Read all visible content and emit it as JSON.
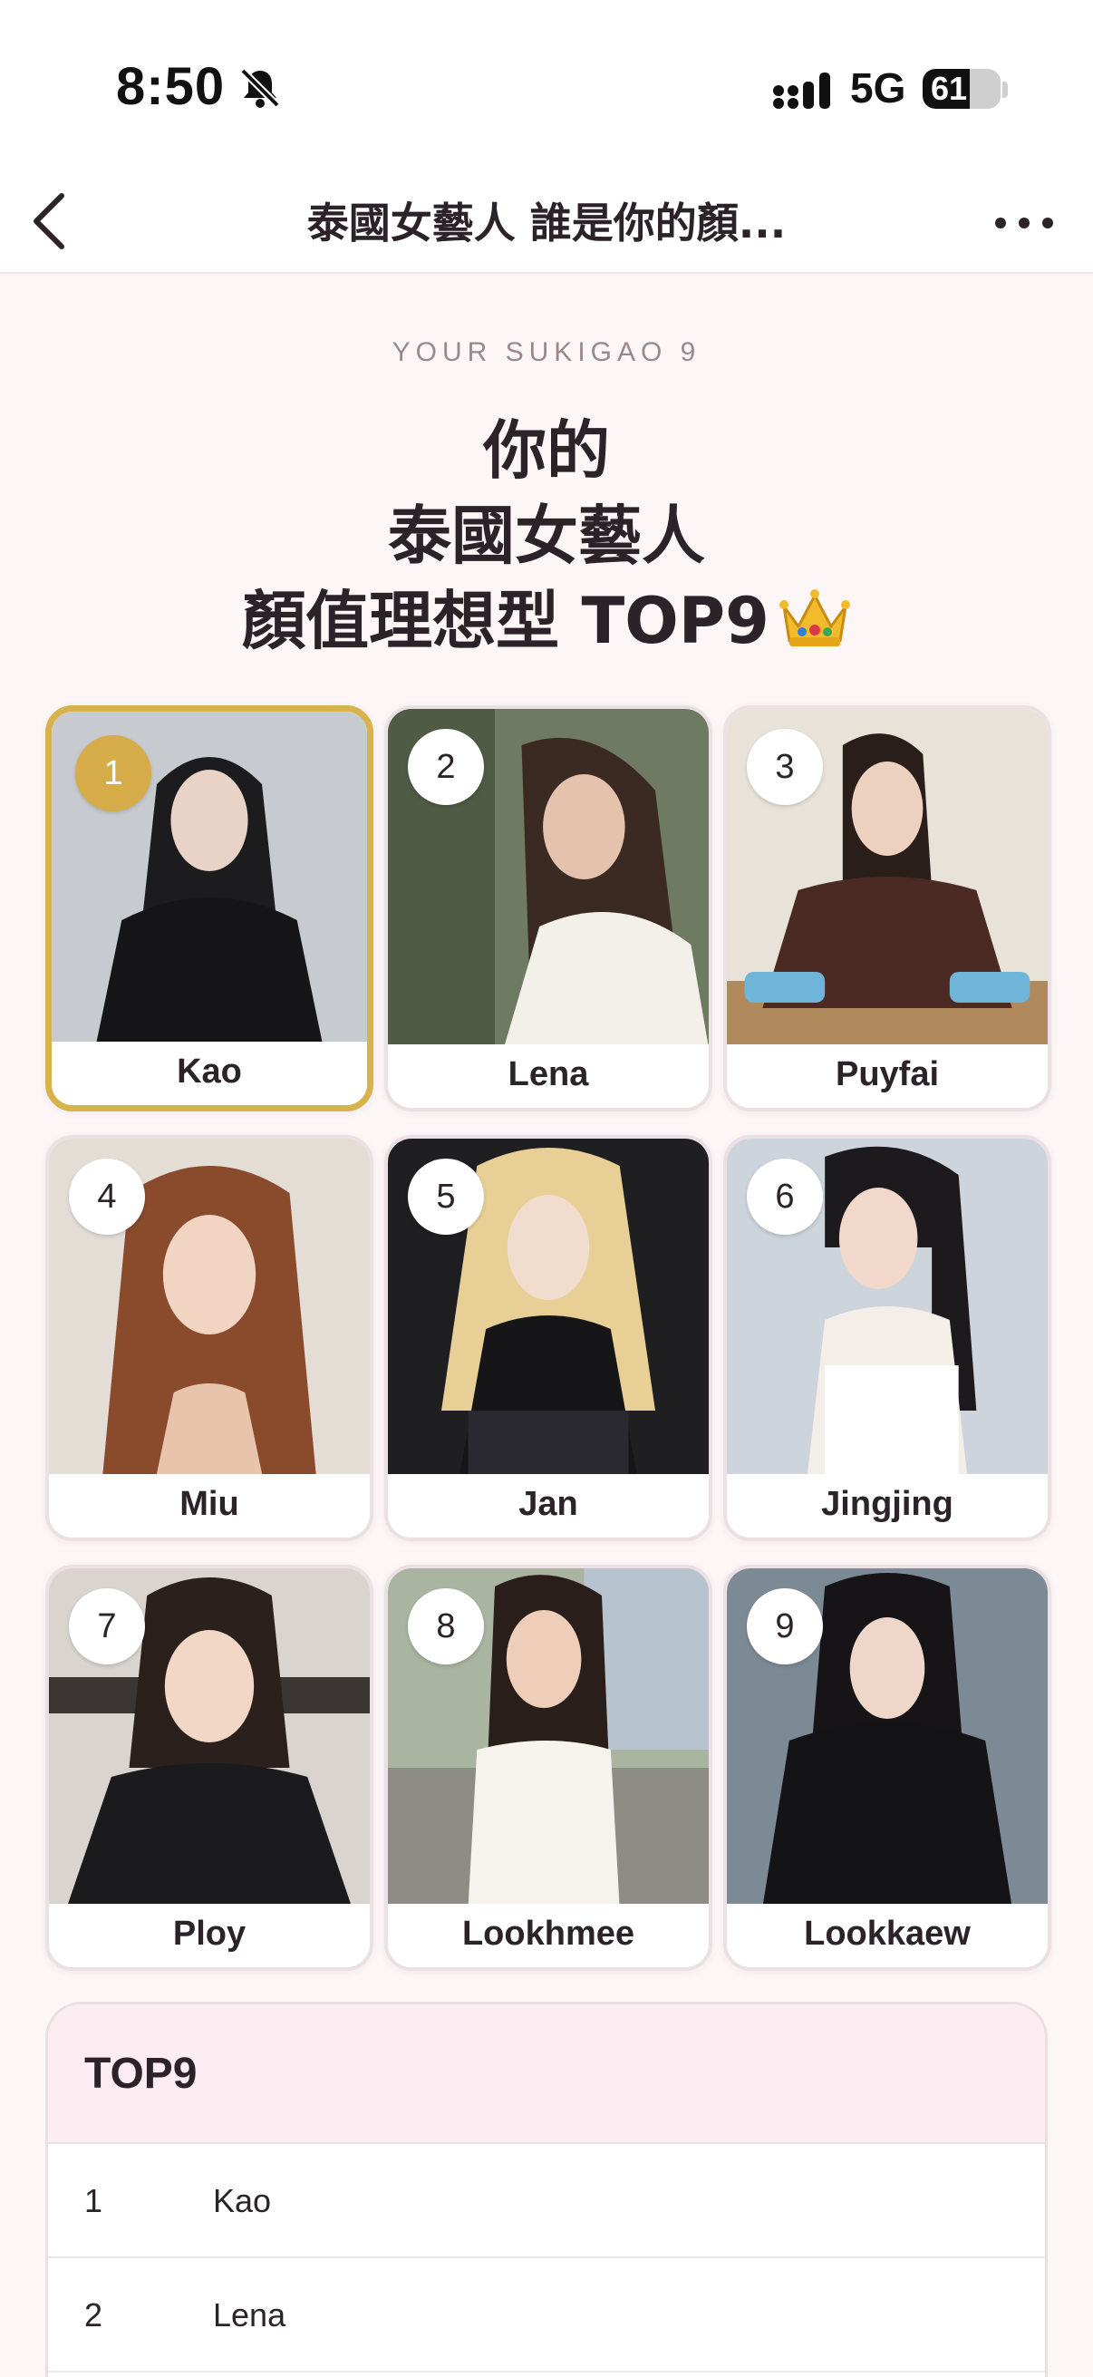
{
  "status_bar": {
    "time": "8:50",
    "network": "5G",
    "battery_level": 61,
    "battery_label": "61",
    "icons": [
      "bell-off-icon",
      "signal-icon",
      "battery-icon"
    ]
  },
  "nav": {
    "title": "泰國女藝人 誰是你的顏...",
    "icons": [
      "back-icon",
      "more-icon"
    ]
  },
  "header": {
    "eyebrow": "YOUR SUKIGAO 9",
    "line1": "你的",
    "line2": "泰國女藝人",
    "line3": "顏值理想型 TOP9",
    "icon": "crown-icon"
  },
  "cards": [
    {
      "rank": "1",
      "name": "Kao"
    },
    {
      "rank": "2",
      "name": "Lena"
    },
    {
      "rank": "3",
      "name": "Puyfai"
    },
    {
      "rank": "4",
      "name": "Miu"
    },
    {
      "rank": "5",
      "name": "Jan"
    },
    {
      "rank": "6",
      "name": "Jingjing"
    },
    {
      "rank": "7",
      "name": "Ploy"
    },
    {
      "rank": "8",
      "name": "Lookhmee"
    },
    {
      "rank": "9",
      "name": "Lookkaew"
    }
  ],
  "table": {
    "title": "TOP9",
    "rows": [
      {
        "rank": "1",
        "name": "Kao"
      },
      {
        "rank": "2",
        "name": "Lena"
      }
    ]
  },
  "colors": {
    "accent_gold": "#d6ac48",
    "background": "#fcf6f7",
    "text": "#2b2327",
    "table_header_bg": "#fbedf1"
  }
}
